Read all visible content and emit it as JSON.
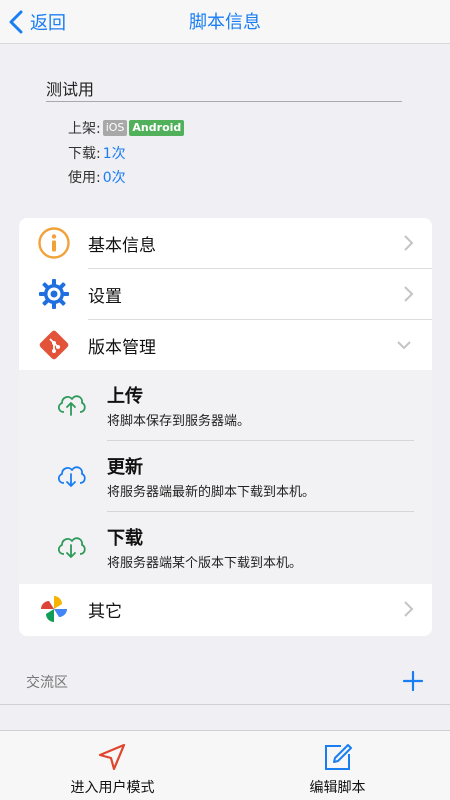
{
  "nav": {
    "back_label": "返回",
    "title": "脚本信息"
  },
  "script": {
    "name": "测试用",
    "platform_label": "上架:",
    "platform_badges": [
      "iOS",
      "Android"
    ],
    "downloads_label": "下载:",
    "downloads_value": "1次",
    "uses_label": "使用:",
    "uses_value": "0次"
  },
  "menu": {
    "basic_info": "基本信息",
    "settings": "设置",
    "version_mgmt": "版本管理",
    "other": "其它"
  },
  "version_actions": [
    {
      "title": "上传",
      "desc": "将脚本保存到服务器端。"
    },
    {
      "title": "更新",
      "desc": "将服务器端最新的脚本下载到本机。"
    },
    {
      "title": "下载",
      "desc": "将服务器端某个版本下载到本机。"
    }
  ],
  "forum": {
    "label": "交流区"
  },
  "tabbar": {
    "user_mode": "进入用户模式",
    "edit_script": "编辑脚本"
  },
  "colors": {
    "accent": "#1a7ef3",
    "green": "#2e9a5a",
    "android": "#51b05a",
    "orange": "#f1a23a"
  }
}
